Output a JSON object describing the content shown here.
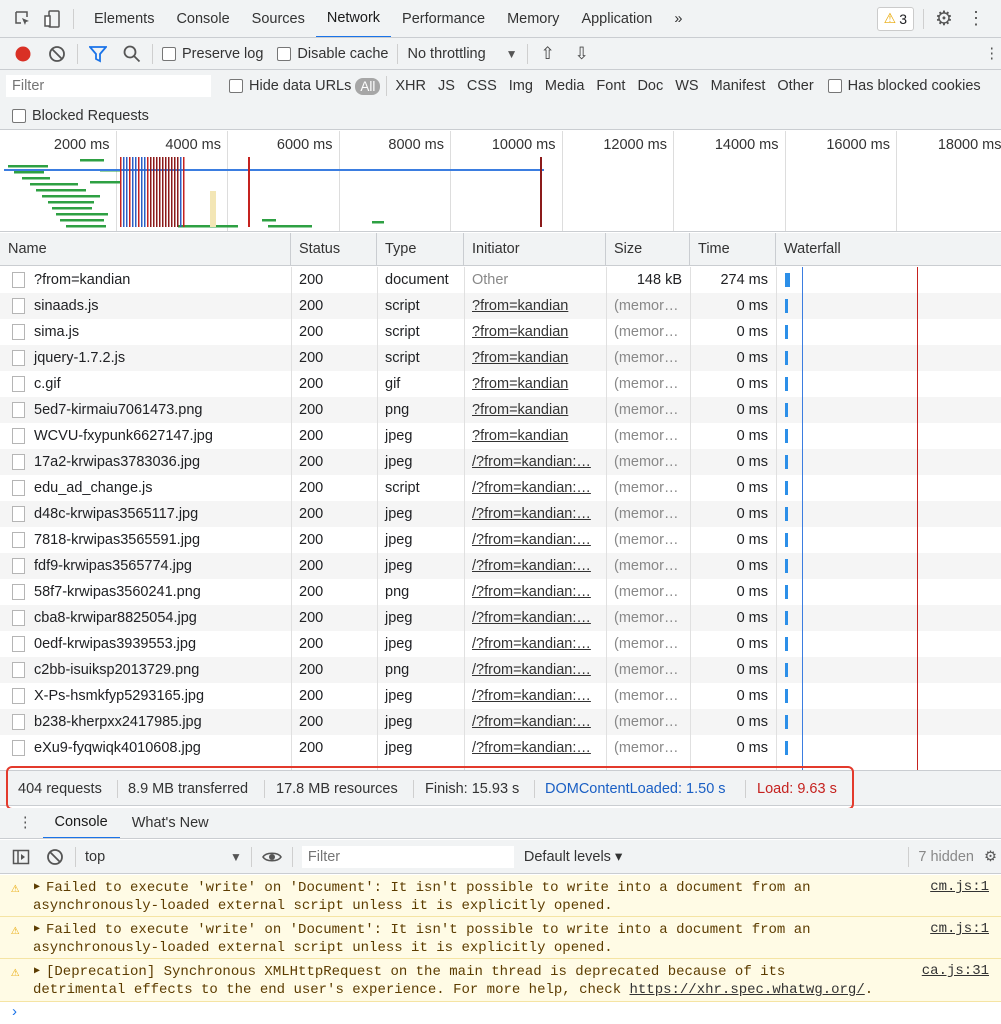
{
  "tabs": [
    "Elements",
    "Console",
    "Sources",
    "Network",
    "Performance",
    "Memory",
    "Application"
  ],
  "more_tabs": "»",
  "warnings_count": "3",
  "toolbar": {
    "preserve_log": "Preserve log",
    "disable_cache": "Disable cache",
    "throttling": "No throttling"
  },
  "filter": {
    "placeholder": "Filter",
    "hide_data_urls": "Hide data URLs",
    "types": [
      "All",
      "XHR",
      "JS",
      "CSS",
      "Img",
      "Media",
      "Font",
      "Doc",
      "WS",
      "Manifest",
      "Other"
    ],
    "has_blocked_cookies": "Has blocked cookies",
    "blocked_requests": "Blocked Requests"
  },
  "overview_ticks": [
    "2000 ms",
    "4000 ms",
    "6000 ms",
    "8000 ms",
    "10000 ms",
    "12000 ms",
    "14000 ms",
    "16000 ms",
    "18000 ms"
  ],
  "columns": [
    "Name",
    "Status",
    "Type",
    "Initiator",
    "Size",
    "Time",
    "Waterfall"
  ],
  "rows": [
    {
      "name": "?from=kandian",
      "status": "200",
      "type": "document",
      "initiator": "Other",
      "size": "148 kB",
      "time": "274 ms"
    },
    {
      "name": "sinaads.js",
      "status": "200",
      "type": "script",
      "initiator": "?from=kandian",
      "size": "(memory…",
      "time": "0 ms"
    },
    {
      "name": "sima.js",
      "status": "200",
      "type": "script",
      "initiator": "?from=kandian",
      "size": "(memory…",
      "time": "0 ms"
    },
    {
      "name": "jquery-1.7.2.js",
      "status": "200",
      "type": "script",
      "initiator": "?from=kandian",
      "size": "(memory…",
      "time": "0 ms"
    },
    {
      "name": "c.gif",
      "status": "200",
      "type": "gif",
      "initiator": "?from=kandian",
      "size": "(memory…",
      "time": "0 ms"
    },
    {
      "name": "5ed7-kirmaiu7061473.png",
      "status": "200",
      "type": "png",
      "initiator": "?from=kandian",
      "size": "(memory…",
      "time": "0 ms"
    },
    {
      "name": "WCVU-fxypunk6627147.jpg",
      "status": "200",
      "type": "jpeg",
      "initiator": "?from=kandian",
      "size": "(memory…",
      "time": "0 ms"
    },
    {
      "name": "17a2-krwipas3783036.jpg",
      "status": "200",
      "type": "jpeg",
      "initiator": "/?from=kandian:…",
      "size": "(memory…",
      "time": "0 ms"
    },
    {
      "name": "edu_ad_change.js",
      "status": "200",
      "type": "script",
      "initiator": "/?from=kandian:…",
      "size": "(memory…",
      "time": "0 ms"
    },
    {
      "name": "d48c-krwipas3565117.jpg",
      "status": "200",
      "type": "jpeg",
      "initiator": "/?from=kandian:…",
      "size": "(memory…",
      "time": "0 ms"
    },
    {
      "name": "7818-krwipas3565591.jpg",
      "status": "200",
      "type": "jpeg",
      "initiator": "/?from=kandian:…",
      "size": "(memory…",
      "time": "0 ms"
    },
    {
      "name": "fdf9-krwipas3565774.jpg",
      "status": "200",
      "type": "jpeg",
      "initiator": "/?from=kandian:…",
      "size": "(memory…",
      "time": "0 ms"
    },
    {
      "name": "58f7-krwipas3560241.png",
      "status": "200",
      "type": "png",
      "initiator": "/?from=kandian:…",
      "size": "(memory…",
      "time": "0 ms"
    },
    {
      "name": "cba8-krwipar8825054.jpg",
      "status": "200",
      "type": "jpeg",
      "initiator": "/?from=kandian:…",
      "size": "(memory…",
      "time": "0 ms"
    },
    {
      "name": "0edf-krwipas3939553.jpg",
      "status": "200",
      "type": "jpeg",
      "initiator": "/?from=kandian:…",
      "size": "(memory…",
      "time": "0 ms"
    },
    {
      "name": "c2bb-isuiksp2013729.png",
      "status": "200",
      "type": "png",
      "initiator": "/?from=kandian:…",
      "size": "(memory…",
      "time": "0 ms"
    },
    {
      "name": "X-Ps-hsmkfyp5293165.jpg",
      "status": "200",
      "type": "jpeg",
      "initiator": "/?from=kandian:…",
      "size": "(memory…",
      "time": "0 ms"
    },
    {
      "name": "b238-kherpxx2417985.jpg",
      "status": "200",
      "type": "jpeg",
      "initiator": "/?from=kandian:…",
      "size": "(memory…",
      "time": "0 ms"
    },
    {
      "name": "eXu9-fyqwiqk4010608.jpg",
      "status": "200",
      "type": "jpeg",
      "initiator": "/?from=kandian:…",
      "size": "(memory…",
      "time": "0 ms"
    }
  ],
  "summary": {
    "requests": "404 requests",
    "transferred": "8.9 MB transferred",
    "resources": "17.8 MB resources",
    "finish": "Finish: 15.93 s",
    "dcl": "DOMContentLoaded: 1.50 s",
    "load": "Load: 9.63 s"
  },
  "drawer_tabs": [
    "Console",
    "What's New"
  ],
  "console_toolbar": {
    "context": "top",
    "filter_placeholder": "Filter",
    "levels": "Default levels ▾",
    "hidden": "7 hidden"
  },
  "messages": [
    {
      "text": "Failed to execute 'write' on 'Document': It isn't possible to write into a document from an\nasynchronously-loaded external script unless it is explicitly opened.",
      "source": "cm.js:1"
    },
    {
      "text": "Failed to execute 'write' on 'Document': It isn't possible to write into a document from an\nasynchronously-loaded external script unless it is explicitly opened.",
      "source": "cm.js:1"
    },
    {
      "text": "[Deprecation] Synchronous XMLHttpRequest on the main thread is deprecated because of its\ndetrimental effects to the end user's experience. For more help, check ",
      "link": "https://xhr.spec.whatwg.org/",
      "source": "ca.js:31"
    }
  ],
  "colors": {
    "accent": "#1a73e8",
    "dcl": "#1a5fc4",
    "load": "#c5221f",
    "highlight": "#e33a2c"
  }
}
